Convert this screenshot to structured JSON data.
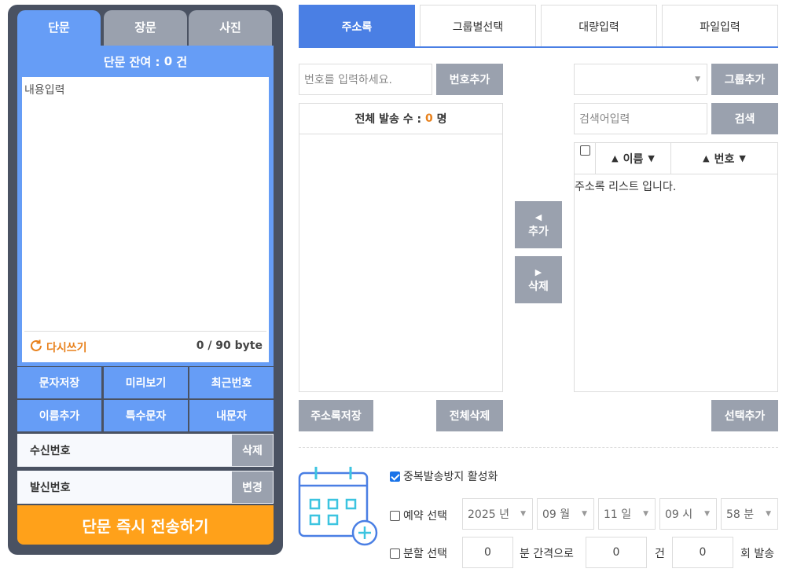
{
  "message_tabs": [
    {
      "label": "단문"
    },
    {
      "label": "장문"
    },
    {
      "label": "사진"
    }
  ],
  "remain": {
    "prefix": "단문 잔여 : ",
    "count": "0",
    "suffix": " 건"
  },
  "message": {
    "placeholder": "내용입력",
    "rewrite_label": "다시쓰기",
    "byte_count": "0 / 90 byte"
  },
  "actions": [
    {
      "label": "문자저장"
    },
    {
      "label": "미리보기"
    },
    {
      "label": "최근번호"
    },
    {
      "label": "이름추가"
    },
    {
      "label": "특수문자"
    },
    {
      "label": "내문자"
    }
  ],
  "receiver": {
    "label": "수신번호",
    "button": "삭제"
  },
  "sender": {
    "label": "발신번호",
    "button": "변경"
  },
  "send_button": "단문 즉시 전송하기",
  "right_tabs": [
    {
      "label": "주소록"
    },
    {
      "label": "그룹별선택"
    },
    {
      "label": "대량입력"
    },
    {
      "label": "파일입력"
    }
  ],
  "number_input": {
    "placeholder": "번호를 입력하세요.",
    "button": "번호추가"
  },
  "total": {
    "prefix": "전체 발송 수 : ",
    "count": "0",
    "suffix": " 명"
  },
  "move": {
    "add": "추가",
    "delete": "삭제"
  },
  "group": {
    "button": "그룹추가"
  },
  "search": {
    "placeholder": "검색어입력",
    "button": "검색"
  },
  "list": {
    "col_name": "이름",
    "col_number": "번호",
    "empty_text": "주소록 리스트 입니다."
  },
  "buttons": {
    "save_addressbook": "주소록저장",
    "delete_all": "전체삭제",
    "add_selected": "선택추가"
  },
  "options": {
    "dup_label": "중복발송방지 활성화",
    "reserve_label": "예약 선택",
    "year": "2025 년",
    "month": "09 월",
    "day": "11 일",
    "hour": "09 시",
    "minute": "58 분",
    "split_label": "분할 선택",
    "split_minutes": "0",
    "split_minutes_unit": "분 간격으로",
    "split_count": "0",
    "split_count_unit": "건",
    "split_times": "0",
    "split_times_unit": "회 발송"
  },
  "colors": {
    "accent": "#669df6",
    "tab_active": "#4a7fe4",
    "send": "#ffa11a",
    "gray": "#9aa1ae",
    "highlight": "#e8811c"
  }
}
